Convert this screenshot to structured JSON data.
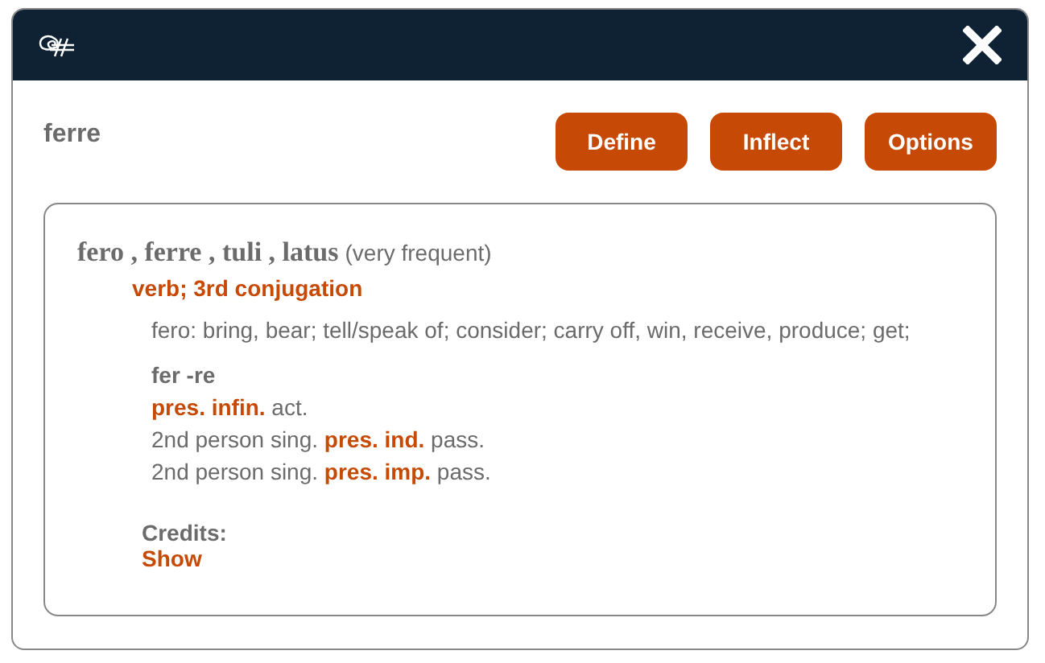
{
  "query": "ferre",
  "buttons": [
    "Define",
    "Inflect",
    "Options"
  ],
  "entry": {
    "headwords": "fero , ferre , tuli , latus",
    "frequency": "(very frequent)",
    "part_of_speech": "verb; 3rd conjugation",
    "definition": "fero: bring, bear; tell/speak of; consider; carry off, win, receive, produce; get;",
    "stem": "fer -re",
    "forms": [
      "**pres. infin.** act.",
      "2nd person sing. **pres. ind.** pass.",
      "2nd person sing. **pres. imp.** pass."
    ]
  },
  "credits": {
    "label": "Credits:",
    "toggle": "Show"
  }
}
